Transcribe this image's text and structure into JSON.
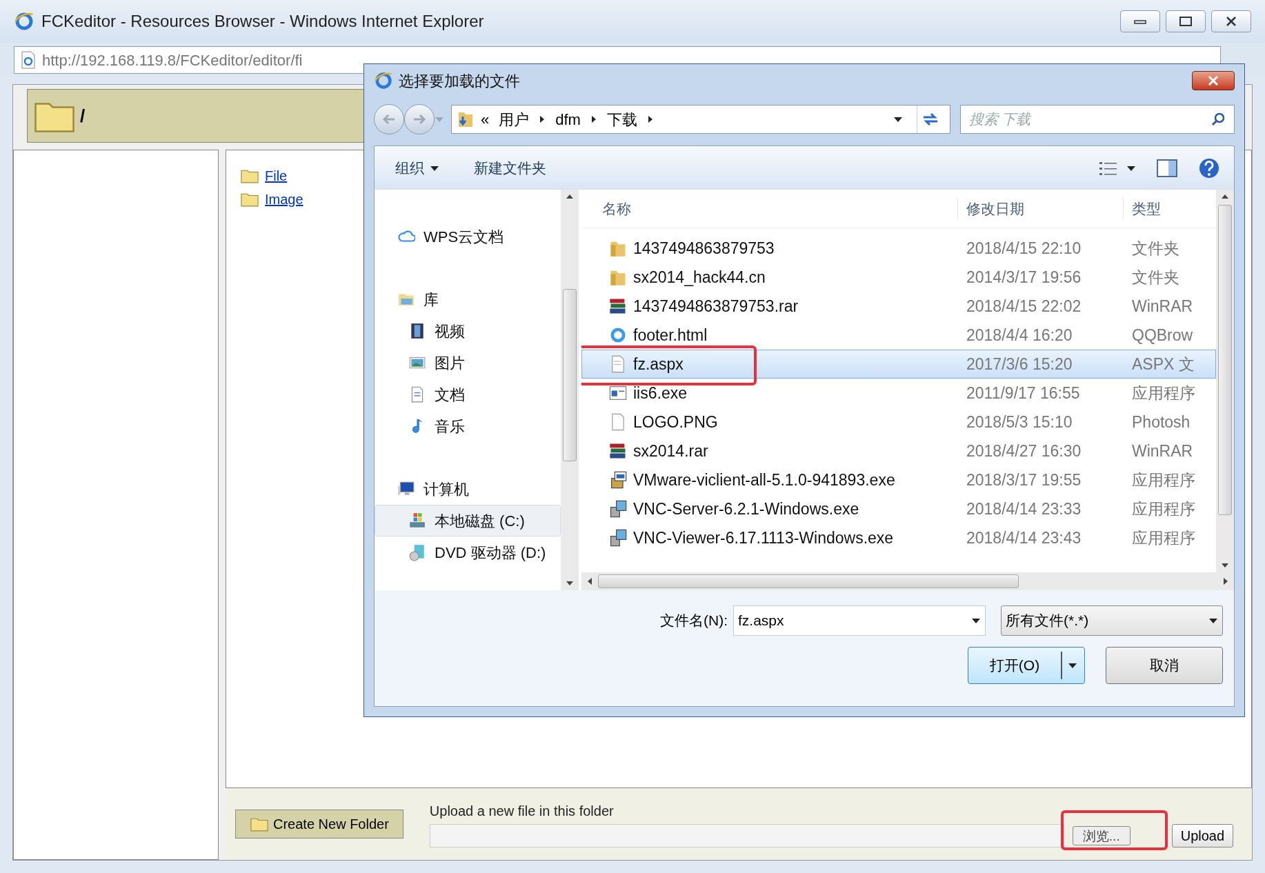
{
  "browser": {
    "title": "FCKeditor - Resources Browser - Windows Internet Explorer",
    "address": "http://192.168.119.8/FCKeditor/editor/fi"
  },
  "page": {
    "current_folder": "/",
    "folders": [
      {
        "label": "File"
      },
      {
        "label": "Image"
      }
    ],
    "create_folder_button": "Create New Folder",
    "upload_label": "Upload a new file in this folder",
    "browse_button": "浏览...",
    "upload_button": "Upload"
  },
  "dialog": {
    "title": "选择要加载的文件",
    "breadcrumb_overflow": "«",
    "breadcrumb": [
      "用户",
      "dfm",
      "下载"
    ],
    "search_placeholder": "搜索 下载",
    "toolbar": [
      "组织",
      "新建文件夹"
    ],
    "nav": [
      {
        "label": "WPS云文档",
        "kind": "cloud",
        "selected": false
      },
      {
        "label": "库",
        "kind": "library",
        "selected": false,
        "children": [
          {
            "label": "视频",
            "kind": "video",
            "selected": false
          },
          {
            "label": "图片",
            "kind": "pictures",
            "selected": false
          },
          {
            "label": "文档",
            "kind": "documents",
            "selected": false
          },
          {
            "label": "音乐",
            "kind": "music",
            "selected": false
          }
        ]
      },
      {
        "label": "计算机",
        "kind": "computer",
        "selected": false,
        "children": [
          {
            "label": "本地磁盘 (C:)",
            "kind": "disk",
            "selected": true
          },
          {
            "label": "DVD 驱动器 (D:)",
            "kind": "dvd",
            "selected": false
          }
        ]
      }
    ],
    "columns": [
      "名称",
      "修改日期",
      "类型"
    ],
    "files": [
      {
        "name": "1437494863879753",
        "date": "2018/4/15 22:10",
        "type": "文件夹",
        "kind": "folder",
        "selected": false
      },
      {
        "name": "sx2014_hack44.cn",
        "date": "2014/3/17 19:56",
        "type": "文件夹",
        "kind": "folder",
        "selected": false
      },
      {
        "name": "1437494863879753.rar",
        "date": "2018/4/15 22:02",
        "type": "WinRAR",
        "kind": "archive",
        "selected": false
      },
      {
        "name": "footer.html",
        "date": "2018/4/4 16:20",
        "type": "QQBrow",
        "kind": "web",
        "selected": false
      },
      {
        "name": "fz.aspx",
        "date": "2017/3/6 15:20",
        "type": "ASPX 文",
        "kind": "document",
        "selected": true
      },
      {
        "name": "iis6.exe",
        "date": "2011/9/17 16:55",
        "type": "应用程序",
        "kind": "app",
        "selected": false
      },
      {
        "name": "LOGO.PNG",
        "date": "2018/5/3 15:10",
        "type": "Photosh",
        "kind": "blank",
        "selected": false
      },
      {
        "name": "sx2014.rar",
        "date": "2018/4/27 16:30",
        "type": "WinRAR",
        "kind": "archive",
        "selected": false
      },
      {
        "name": "VMware-viclient-all-5.1.0-941893.exe",
        "date": "2018/3/17 19:55",
        "type": "应用程序",
        "kind": "installer",
        "selected": false
      },
      {
        "name": "VNC-Server-6.2.1-Windows.exe",
        "date": "2018/4/14 23:33",
        "type": "应用程序",
        "kind": "setup",
        "selected": false
      },
      {
        "name": "VNC-Viewer-6.17.1113-Windows.exe",
        "date": "2018/4/14 23:43",
        "type": "应用程序",
        "kind": "setup",
        "selected": false
      }
    ],
    "file_name_label": "文件名(N):",
    "file_name": "fz.aspx",
    "filter": "所有文件(*.*)",
    "open_button": "打开(O)",
    "cancel_button": "取消"
  }
}
